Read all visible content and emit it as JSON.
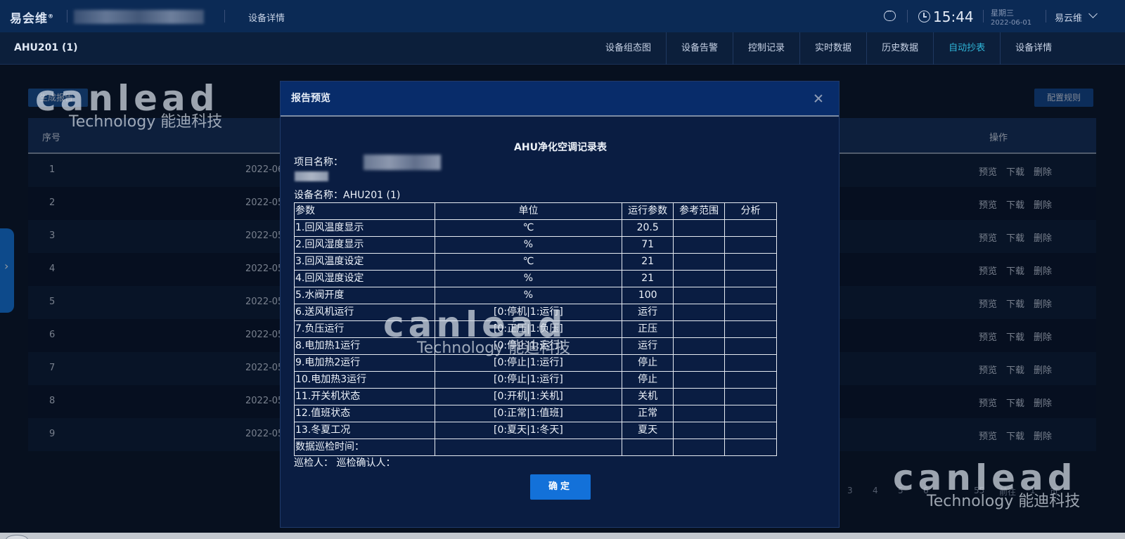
{
  "header": {
    "logo": "易会维",
    "breadcrumb": "设备详情",
    "time": "15:44",
    "weekday": "星期三",
    "date": "2022-06-01",
    "user": "易云维"
  },
  "device": {
    "title": "AHU201 (1)"
  },
  "tabs": [
    {
      "label": "设备组态图"
    },
    {
      "label": "设备告警"
    },
    {
      "label": "控制记录"
    },
    {
      "label": "实时数据"
    },
    {
      "label": "历史数据"
    },
    {
      "label": "自动抄表",
      "active": true
    },
    {
      "label": "设备详情"
    }
  ],
  "toolbar": {
    "generate_label": "生成报告",
    "rules_label": "配置规则"
  },
  "list": {
    "headers": {
      "index": "序号",
      "ops": "操作"
    },
    "op_labels": {
      "preview": "预览",
      "download": "下载",
      "delete": "删除"
    },
    "rows": [
      {
        "index": "1",
        "date": "2022-06"
      },
      {
        "index": "2",
        "date": "2022-05"
      },
      {
        "index": "3",
        "date": "2022-05"
      },
      {
        "index": "4",
        "date": "2022-05"
      },
      {
        "index": "5",
        "date": "2022-05"
      },
      {
        "index": "6",
        "date": "2022-05"
      },
      {
        "index": "7",
        "date": "2022-05"
      },
      {
        "index": "8",
        "date": "2022-05"
      },
      {
        "index": "9",
        "date": "2022-05"
      }
    ]
  },
  "pager": {
    "pages": [
      "3",
      "4",
      "5",
      "6",
      "",
      "55"
    ],
    "goto_label": "前往",
    "goto_value": "1",
    "page_suffix": "页"
  },
  "modal": {
    "title": "报告预览",
    "report_title": "AHU净化空调记录表",
    "project_label": "项目名称：",
    "device_label": "设备名称：AHU201 (1)",
    "table_header": [
      "参数",
      "单位",
      "运行参数",
      "参考范围",
      "分析"
    ],
    "rows": [
      {
        "param": "1.回风温度显示",
        "unit": "℃",
        "value": "20.5"
      },
      {
        "param": "2.回风湿度显示",
        "unit": "%",
        "value": "71"
      },
      {
        "param": "3.回风温度设定",
        "unit": "℃",
        "value": "21"
      },
      {
        "param": "4.回风湿度设定",
        "unit": "%",
        "value": "21"
      },
      {
        "param": "5.水阀开度",
        "unit": "%",
        "value": "100"
      },
      {
        "param": "6.送风机运行",
        "unit": "[0:停机|1:运行]",
        "value": "运行"
      },
      {
        "param": "7.负压运行",
        "unit": "[0:正压|1:负压]",
        "value": "正压"
      },
      {
        "param": "8.电加热1运行",
        "unit": "[0:停止|1:运行]",
        "value": "运行"
      },
      {
        "param": "9.电加热2运行",
        "unit": "[0:停止|1:运行]",
        "value": "停止"
      },
      {
        "param": "10.电加热3运行",
        "unit": "[0:停止|1:运行]",
        "value": "停止"
      },
      {
        "param": "11.开关机状态",
        "unit": "[0:开机|1:关机]",
        "value": "关机"
      },
      {
        "param": "12.值班状态",
        "unit": "[0:正常|1:值班]",
        "value": "正常"
      },
      {
        "param": "13.冬夏工况",
        "unit": "[0:夏天|1:冬天]",
        "value": "夏天"
      }
    ],
    "inspect_time_label": "数据巡检时间：",
    "inspector_label": "巡检人：  巡检确认人：",
    "confirm_label": "确定"
  },
  "watermark": {
    "brand": "canlead",
    "tagline": "Technology 能迪科技"
  },
  "colors": {
    "accent": "#1371d9",
    "active_tab": "#2fb6d8",
    "header_bg": "#0b2a55"
  }
}
